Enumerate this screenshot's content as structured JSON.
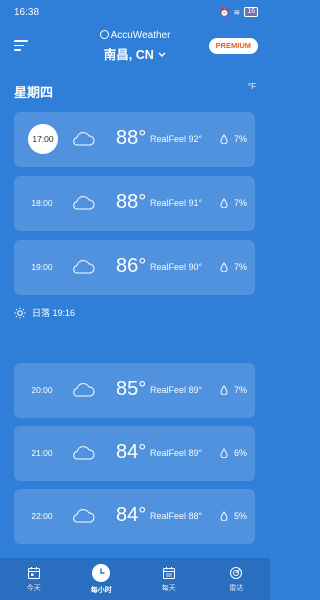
{
  "status": {
    "time": "16:38",
    "battery": "16"
  },
  "header": {
    "brand": "AccuWeather",
    "location": "南昌, CN",
    "premium_label": "PREMIUM"
  },
  "day": {
    "title": "星期四",
    "unit": "°F"
  },
  "hours_top": [
    {
      "time": "17:00",
      "temp": "88°",
      "realfeel": "RealFeel 92°",
      "precip": "7%"
    },
    {
      "time": "18:00",
      "temp": "88°",
      "realfeel": "RealFeel 91°",
      "precip": "7%"
    },
    {
      "time": "19:00",
      "temp": "86°",
      "realfeel": "RealFeel 90°",
      "precip": "7%"
    }
  ],
  "sunset": {
    "label": "日落 19:16"
  },
  "hours_bottom": [
    {
      "time": "20:00",
      "temp": "85°",
      "realfeel": "RealFeel 89°",
      "precip": "7%"
    },
    {
      "time": "21:00",
      "temp": "84°",
      "realfeel": "RealFeel 89°",
      "precip": "6%"
    },
    {
      "time": "22:00",
      "temp": "84°",
      "realfeel": "RealFeel 88°",
      "precip": "5%"
    }
  ],
  "tabs": [
    {
      "label": "今天",
      "icon": "calendar-icon"
    },
    {
      "label": "每小时",
      "icon": "clock-icon"
    },
    {
      "label": "每天",
      "icon": "calendar-icon"
    },
    {
      "label": "雷达",
      "icon": "radar-icon"
    }
  ],
  "colors": {
    "background": "#2f7ed8",
    "premium_text": "#f05a22",
    "tab_bar": "#2a6fbf"
  }
}
